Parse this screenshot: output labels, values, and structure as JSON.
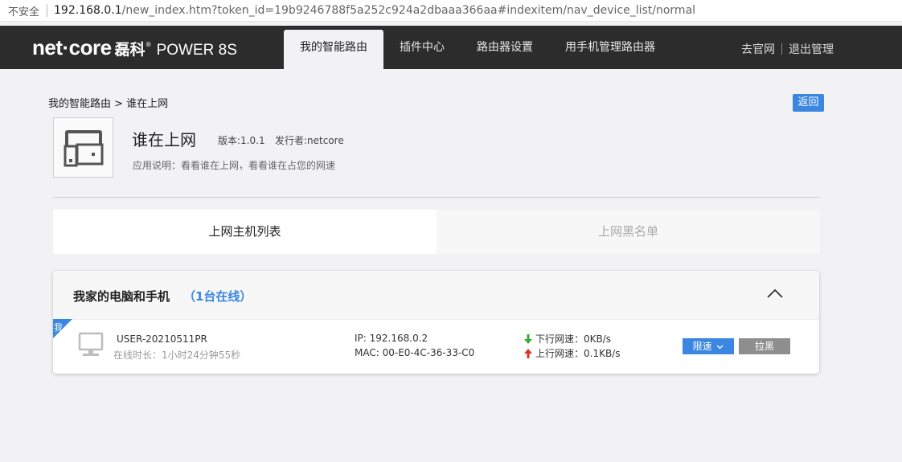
{
  "addressbar": {
    "security_label": "不安全",
    "url_host": "192.168.0.1",
    "url_rest": "/new_index.htm?token_id=19b9246788f5a252c924a2dbaaa366aa#indexitem/nav_device_list/normal"
  },
  "nav": {
    "brand": "net·core",
    "brand_cn": "磊科",
    "reg": "®",
    "model": "POWER 8S",
    "tabs": [
      "我的智能路由",
      "插件中心",
      "路由器设置",
      "用手机管理路由器"
    ],
    "active_tab": 0,
    "official_site": "去官网",
    "logout": "退出管理"
  },
  "breadcrumb": "我的智能路由 > 谁在上网",
  "back_label": "返回",
  "app": {
    "title": "谁在上网",
    "version": "版本:1.0.1",
    "publisher": "发行者:netcore",
    "description": "应用说明：看看谁在上网，看看谁在占您的网速"
  },
  "subtabs": [
    "上网主机列表",
    "上网黑名单"
  ],
  "group": {
    "title": "我家的电脑和手机",
    "count": "（1台在线）"
  },
  "device": {
    "badge": "我",
    "name": "USER-20210511PR",
    "online": "在线时长：1小时24分钟55秒",
    "ip": "IP: 192.168.0.2",
    "mac": "MAC: 00-E0-4C-36-33-C0",
    "down": "下行网速：0KB/s",
    "up": "上行网速：0.1KB/s",
    "limit_label": "限速",
    "block_label": "拉黑"
  },
  "colors": {
    "accent": "#3a86e0",
    "nav_bg": "#2c2c2c",
    "down_arrow": "#3aa93a",
    "up_arrow": "#e0302a"
  }
}
